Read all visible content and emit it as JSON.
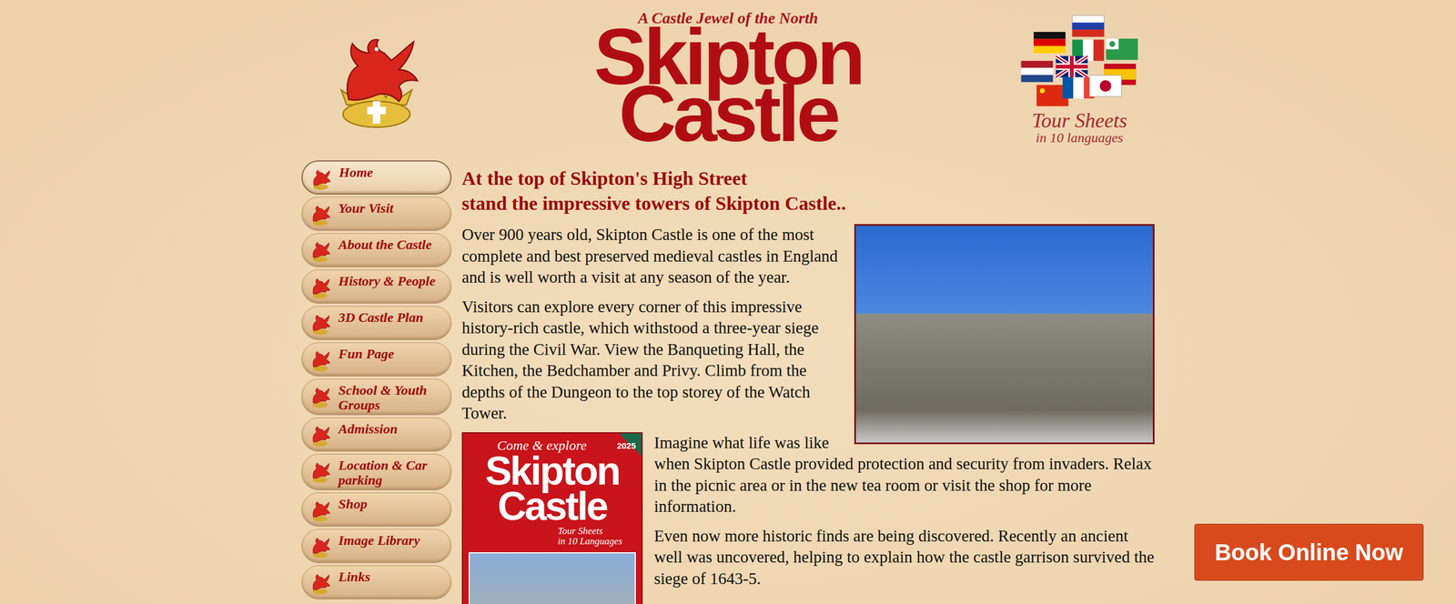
{
  "logo": {
    "tagline": "A Castle Jewel of the North",
    "title_lines": [
      "Skipton",
      "Castle"
    ]
  },
  "tour_sheets": {
    "lines": [
      "Tour Sheets",
      "in 10 languages"
    ]
  },
  "nav": [
    {
      "label": "Home",
      "selected": true
    },
    {
      "label": "Your Visit",
      "selected": false
    },
    {
      "label": "About the Castle",
      "selected": false
    },
    {
      "label": "History & People",
      "selected": false
    },
    {
      "label": "3D Castle Plan",
      "selected": false
    },
    {
      "label": "Fun Page",
      "selected": false
    },
    {
      "label": "School & Youth Groups",
      "selected": false
    },
    {
      "label": "Admission",
      "selected": false
    },
    {
      "label": "Location & Car parking",
      "selected": false
    },
    {
      "label": "Shop",
      "selected": false
    },
    {
      "label": "Image Library",
      "selected": false
    },
    {
      "label": "Links",
      "selected": false
    }
  ],
  "heading": [
    "At the top of Skipton's High Street",
    "stand the impressive towers of Skipton Castle.."
  ],
  "paragraphs_top": [
    "Over 900 years old, Skipton Castle is one of the most complete and best preserved medieval castles in England and is well worth a visit at any season of the year.",
    "Visitors can explore every corner of this impressive history-rich castle, which withstood a three-year siege during the Civil War. View the Banqueting Hall, the Kitchen, the Bedchamber and Privy. Climb from the depths of the Dungeon to the top storey of the Watch Tower."
  ],
  "leaflet": {
    "kicker": "Come & explore",
    "year": "2025",
    "title_lines": [
      "Skipton",
      "Castle"
    ],
    "caption_lines": [
      "Tour Sheets",
      "in 10 Languages"
    ]
  },
  "paragraphs_bottom": [
    "Imagine what life was like when Skipton Castle provided protection and security from invaders. Relax in the picnic area or in the new tea room or visit the shop for more information.",
    "Even now more historic finds are being discovered. Recently an ancient well was uncovered, helping to explain how the castle garrison survived the siege of 1643-5."
  ],
  "book_button": "Book Online Now"
}
